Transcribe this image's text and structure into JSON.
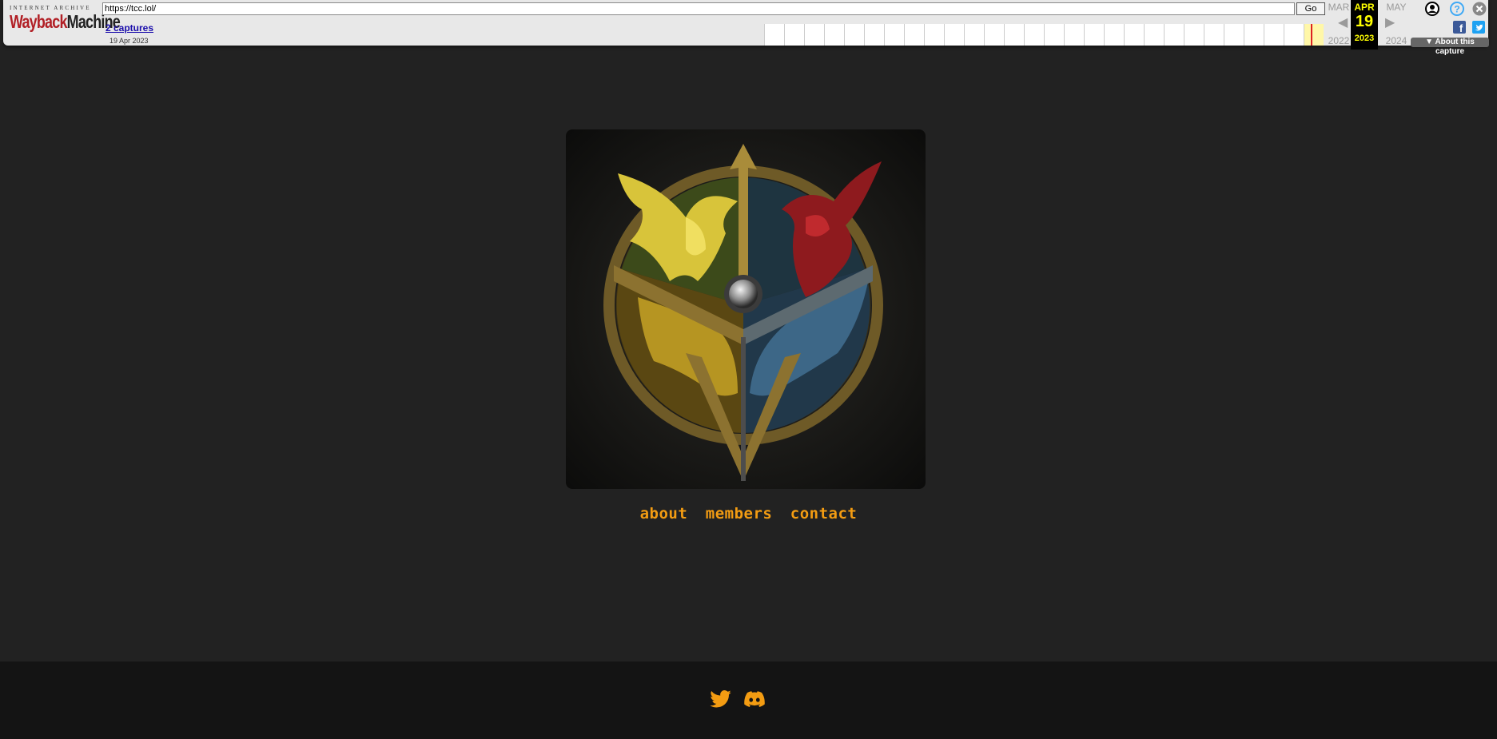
{
  "wayback": {
    "logo_top": "INTERNET ARCHIVE",
    "logo_word1": "Wayback",
    "logo_word2": "Machine",
    "url": "https://tcc.lol/",
    "go_label": "Go",
    "captures_label": "2 captures",
    "capture_date": "19 Apr 2023",
    "prev_month": "MAR",
    "prev_year": "2022",
    "current_month": "APR",
    "current_day": "19",
    "current_year": "2023",
    "next_month": "MAY",
    "next_year": "2024",
    "about_label": "About this capture"
  },
  "nav": {
    "links": [
      "about",
      "members",
      "contact"
    ]
  },
  "colors": {
    "background": "#222222",
    "footer": "#141414",
    "accent": "#f39c12"
  },
  "footer": {
    "icons": [
      "twitter-icon",
      "discord-icon"
    ]
  }
}
